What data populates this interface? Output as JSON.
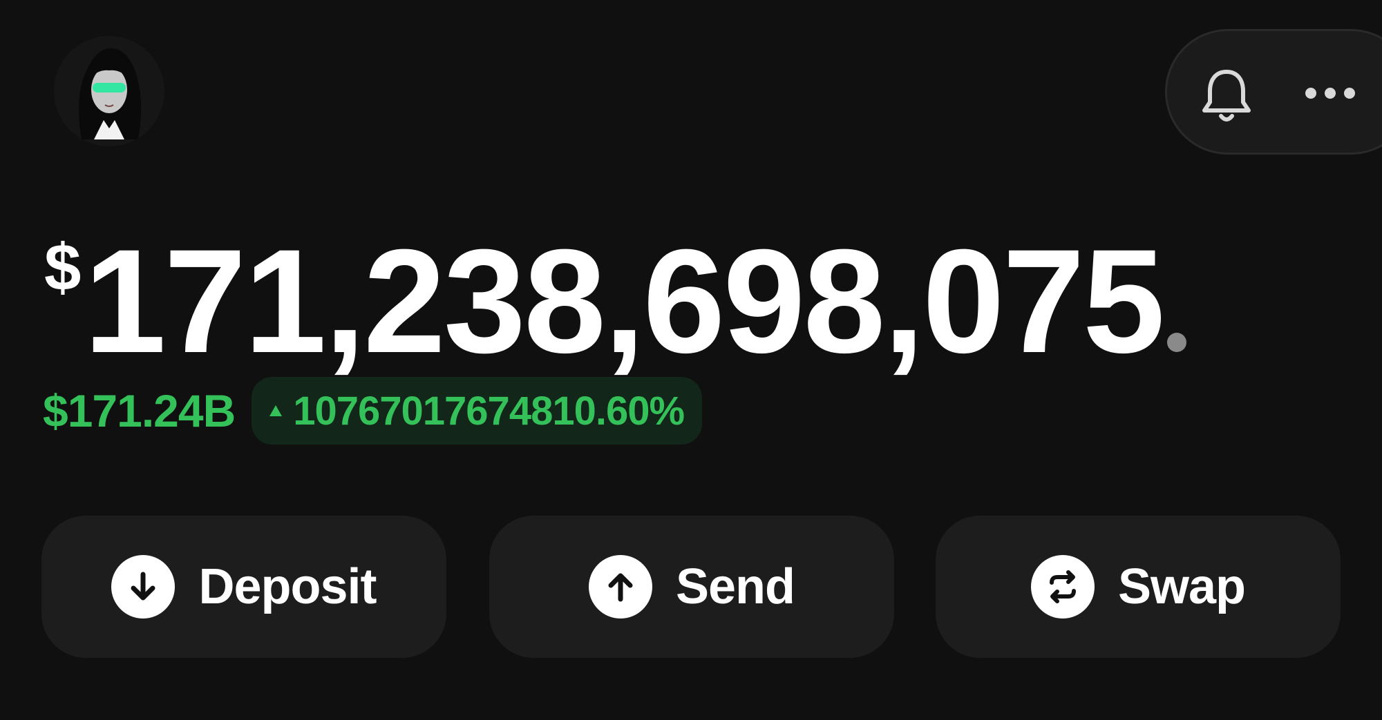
{
  "header": {
    "avatar_icon": "user-avatar-icon",
    "notifications_icon": "bell-icon",
    "more_icon": "more-horizontal-icon"
  },
  "balance": {
    "currency_symbol": "$",
    "amount": "171,238,698,075"
  },
  "change": {
    "absolute": "$171.24B",
    "direction_icon": "triangle-up-icon",
    "percent": "10767017674810.60%",
    "color": "#35c15a"
  },
  "actions": [
    {
      "label": "Deposit",
      "icon": "arrow-down-circle-icon"
    },
    {
      "label": "Send",
      "icon": "arrow-up-circle-icon"
    },
    {
      "label": "Swap",
      "icon": "swap-arrows-icon"
    }
  ],
  "colors": {
    "background": "#101010",
    "surface": "#1d1d1d",
    "accent_green": "#35c15a",
    "text": "#ffffff"
  }
}
